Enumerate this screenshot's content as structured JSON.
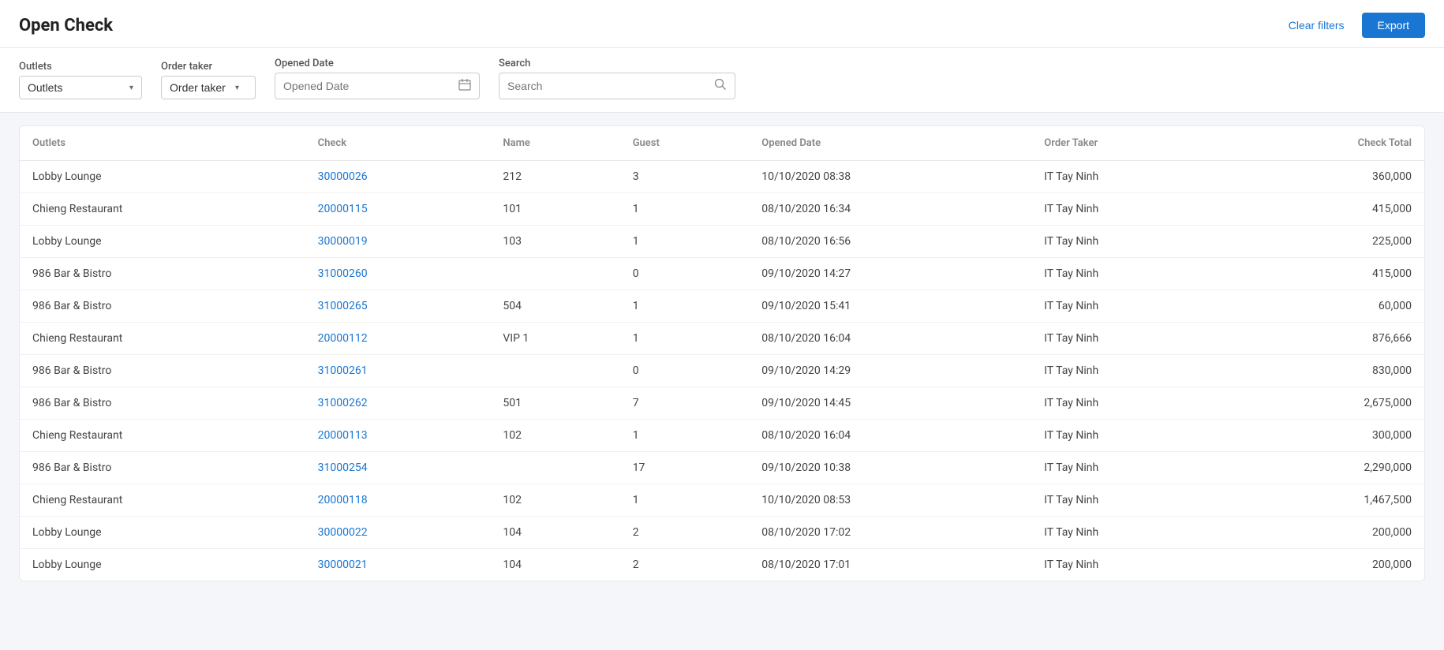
{
  "header": {
    "title": "Open Check",
    "clear_filters_label": "Clear filters",
    "export_label": "Export"
  },
  "filters": {
    "outlets": {
      "label": "Outlets",
      "value": "Outlets",
      "options": [
        "Outlets",
        "Lobby Lounge",
        "Chieng Restaurant",
        "986 Bar & Bistro"
      ]
    },
    "order_taker": {
      "label": "Order taker",
      "value": "Order taker",
      "options": [
        "Order taker",
        "IT Tay Ninh"
      ]
    },
    "opened_date": {
      "label": "Opened Date",
      "placeholder": "Opened Date"
    },
    "search": {
      "label": "Search",
      "placeholder": "Search"
    }
  },
  "table": {
    "columns": [
      "Outlets",
      "Check",
      "Name",
      "Guest",
      "Opened Date",
      "Order Taker",
      "Check Total"
    ],
    "rows": [
      {
        "outlet": "Lobby Lounge",
        "check": "30000026",
        "name": "212",
        "guest": "3",
        "opened_date": "10/10/2020 08:38",
        "order_taker": "IT Tay Ninh",
        "check_total": "360,000"
      },
      {
        "outlet": "Chieng Restaurant",
        "check": "20000115",
        "name": "101",
        "guest": "1",
        "opened_date": "08/10/2020 16:34",
        "order_taker": "IT Tay Ninh",
        "check_total": "415,000"
      },
      {
        "outlet": "Lobby Lounge",
        "check": "30000019",
        "name": "103",
        "guest": "1",
        "opened_date": "08/10/2020 16:56",
        "order_taker": "IT Tay Ninh",
        "check_total": "225,000"
      },
      {
        "outlet": "986 Bar & Bistro",
        "check": "31000260",
        "name": "",
        "guest": "0",
        "opened_date": "09/10/2020 14:27",
        "order_taker": "IT Tay Ninh",
        "check_total": "415,000"
      },
      {
        "outlet": "986 Bar & Bistro",
        "check": "31000265",
        "name": "504",
        "guest": "1",
        "opened_date": "09/10/2020 15:41",
        "order_taker": "IT Tay Ninh",
        "check_total": "60,000"
      },
      {
        "outlet": "Chieng Restaurant",
        "check": "20000112",
        "name": "VIP 1",
        "guest": "1",
        "opened_date": "08/10/2020 16:04",
        "order_taker": "IT Tay Ninh",
        "check_total": "876,666"
      },
      {
        "outlet": "986 Bar & Bistro",
        "check": "31000261",
        "name": "",
        "guest": "0",
        "opened_date": "09/10/2020 14:29",
        "order_taker": "IT Tay Ninh",
        "check_total": "830,000"
      },
      {
        "outlet": "986 Bar & Bistro",
        "check": "31000262",
        "name": "501",
        "guest": "7",
        "opened_date": "09/10/2020 14:45",
        "order_taker": "IT Tay Ninh",
        "check_total": "2,675,000"
      },
      {
        "outlet": "Chieng Restaurant",
        "check": "20000113",
        "name": "102",
        "guest": "1",
        "opened_date": "08/10/2020 16:04",
        "order_taker": "IT Tay Ninh",
        "check_total": "300,000"
      },
      {
        "outlet": "986 Bar & Bistro",
        "check": "31000254",
        "name": "",
        "guest": "17",
        "opened_date": "09/10/2020 10:38",
        "order_taker": "IT Tay Ninh",
        "check_total": "2,290,000"
      },
      {
        "outlet": "Chieng Restaurant",
        "check": "20000118",
        "name": "102",
        "guest": "1",
        "opened_date": "10/10/2020 08:53",
        "order_taker": "IT Tay Ninh",
        "check_total": "1,467,500"
      },
      {
        "outlet": "Lobby Lounge",
        "check": "30000022",
        "name": "104",
        "guest": "2",
        "opened_date": "08/10/2020 17:02",
        "order_taker": "IT Tay Ninh",
        "check_total": "200,000"
      },
      {
        "outlet": "Lobby Lounge",
        "check": "30000021",
        "name": "104",
        "guest": "2",
        "opened_date": "08/10/2020 17:01",
        "order_taker": "IT Tay Ninh",
        "check_total": "200,000"
      }
    ]
  },
  "icons": {
    "chevron": "▾",
    "calendar": "📅",
    "search": "🔍"
  }
}
